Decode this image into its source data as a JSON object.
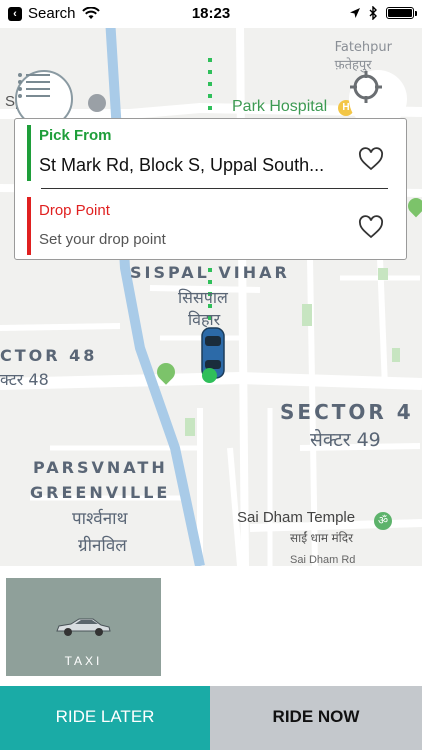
{
  "status_bar": {
    "back_label": "Search",
    "time": "18:23",
    "icons": [
      "wifi-icon",
      "location-arrow-icon",
      "bluetooth-icon",
      "battery-icon"
    ]
  },
  "map": {
    "areas": [
      {
        "name": "SISPAL VIHAR",
        "hindi_1": "सिसपाल",
        "hindi_2": "विहार"
      },
      {
        "name": "CTOR 48",
        "hindi": "क्टर 48"
      },
      {
        "name": "SECTOR 4",
        "hindi": "सेक्टर 49"
      },
      {
        "name_1": "PARSVNATH",
        "name_2": "GREENVILLE",
        "hindi_1": "पार्श्वनाथ",
        "hindi_2": "ग्रीनविल"
      }
    ],
    "top_right_fragment": "Fatehpur",
    "top_right_fragment_hindi": "फ़तेहपुर",
    "pois": [
      {
        "label": "Spazedge"
      },
      {
        "label": "Park Hospital"
      },
      {
        "label": "Sai Dham Temple",
        "hindi": "साईं धाम मंदिर"
      }
    ],
    "road_label": "Sai Dham Rd"
  },
  "location_card": {
    "pick_label": "Pick From",
    "pick_value": "St Mark Rd, Block S, Uppal South...",
    "drop_label": "Drop Point",
    "drop_placeholder": "Set your drop point"
  },
  "vehicle": {
    "label": "TAXI"
  },
  "buttons": {
    "ride_later": "RIDE LATER",
    "ride_now": "RIDE NOW"
  },
  "colors": {
    "pick_accent": "#1e9e3a",
    "drop_accent": "#e02020",
    "ride_later_bg": "#1aaba6",
    "ride_now_bg": "#c4c8cc",
    "taxi_card_bg": "#8fa09a"
  }
}
